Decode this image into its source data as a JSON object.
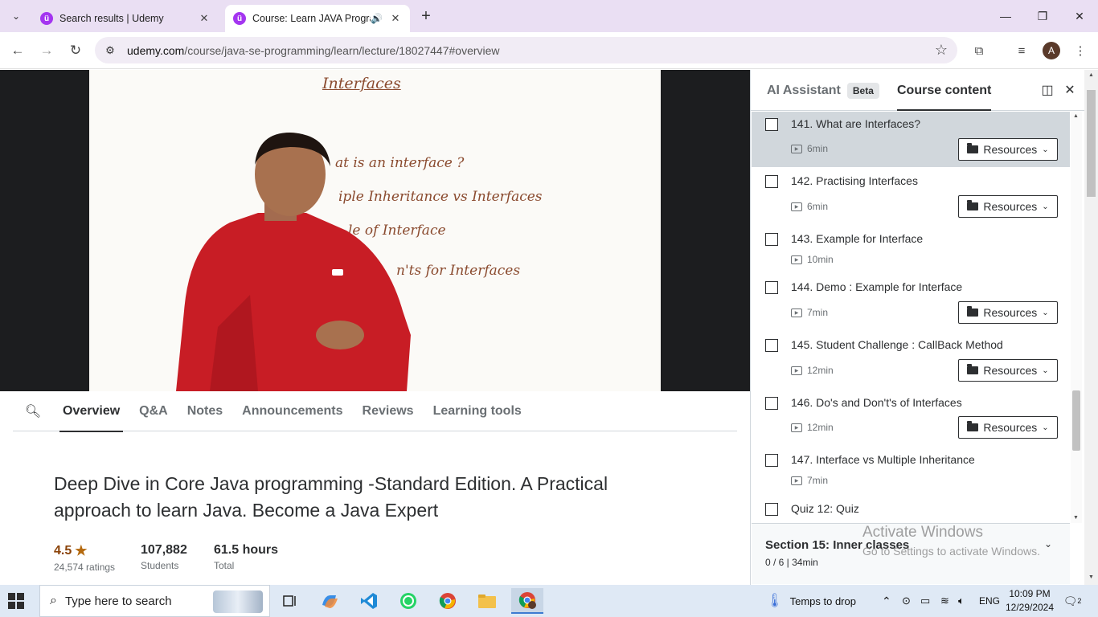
{
  "browser": {
    "tabs": [
      {
        "title": "Search results | Udemy",
        "active": false
      },
      {
        "title": "Course: Learn JAVA Program",
        "active": true,
        "audio": true
      }
    ],
    "url_domain": "udemy.com",
    "url_path": "/course/java-se-programming/learn/lecture/18027447#overview",
    "profile_initial": "A",
    "favicon_letter": "ü"
  },
  "video": {
    "board_title": "Interfaces",
    "board_lines": [
      "at is an interface ?",
      "iple Inheritance  vs   Interfaces",
      "le of Interface",
      "n'ts  for Interfaces"
    ]
  },
  "lecture_tabs": [
    "Overview",
    "Q&A",
    "Notes",
    "Announcements",
    "Reviews",
    "Learning tools"
  ],
  "course": {
    "title": "Deep Dive in Core Java programming -Standard Edition. A Practical approach to learn Java. Become a Java Expert",
    "rating": "4.5",
    "ratings_count": "24,574 ratings",
    "students": "107,882",
    "students_label": "Students",
    "hours": "61.5 hours",
    "hours_label": "Total"
  },
  "sidebar": {
    "ai_tab": "AI Assistant",
    "beta": "Beta",
    "content_tab": "Course content",
    "lectures": [
      {
        "title": "141. What are Interfaces?",
        "duration": "6min",
        "resources": "Resources",
        "has_resources": true,
        "current": true
      },
      {
        "title": "142. Practising Interfaces",
        "duration": "6min",
        "resources": "Resources",
        "has_resources": true
      },
      {
        "title": "143. Example for Interface",
        "duration": "10min",
        "has_resources": false
      },
      {
        "title": "144. Demo : Example for Interface",
        "duration": "7min",
        "resources": "Resources",
        "has_resources": true
      },
      {
        "title": "145. Student Challenge : CallBack Method",
        "duration": "12min",
        "resources": "Resources",
        "has_resources": true
      },
      {
        "title": "146. Do's and Don't's of Interfaces",
        "duration": "12min",
        "resources": "Resources",
        "has_resources": true
      },
      {
        "title": "147. Interface vs Multiple Inheritance",
        "duration": "7min",
        "has_resources": false
      },
      {
        "title": "Quiz 12: Quiz",
        "duration": "",
        "has_resources": false
      }
    ],
    "section": {
      "title": "Section 15: Inner classes",
      "meta": "0 / 6 | 34min"
    }
  },
  "watermark": {
    "line1": "Activate Windows",
    "line2": "Go to Settings to activate Windows."
  },
  "taskbar": {
    "search_placeholder": "Type here to search",
    "weather": "Temps to drop",
    "language": "ENG",
    "time": "10:09 PM",
    "date": "12/29/2024",
    "notifications": "2"
  },
  "colors": {
    "udemy_purple": "#a435f0",
    "rating_star": "#b4690e",
    "chrome_frame": "#eadff3"
  }
}
